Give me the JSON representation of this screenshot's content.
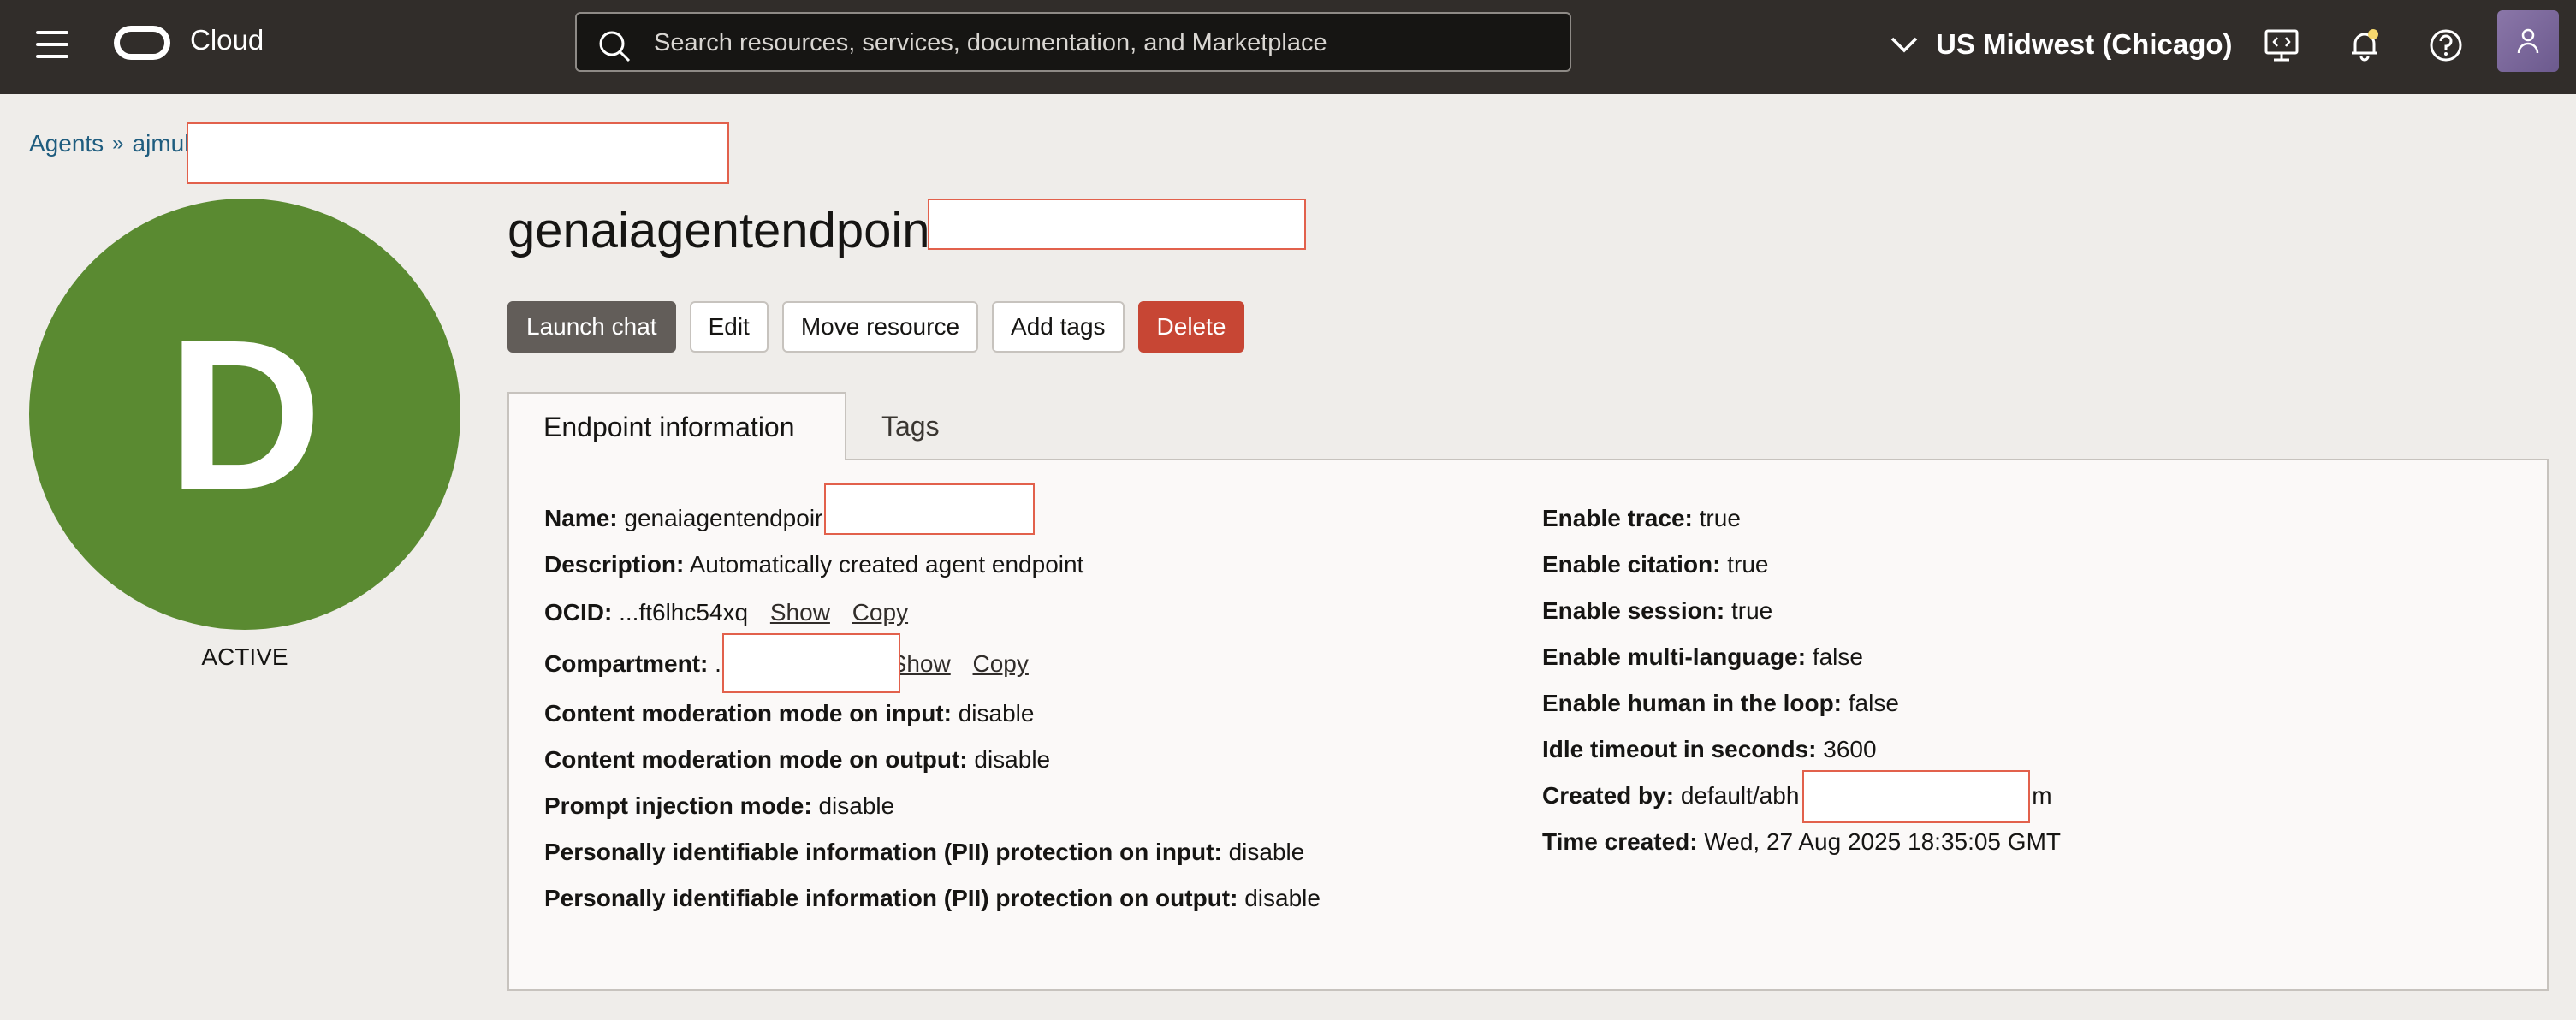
{
  "header": {
    "brand": "Cloud",
    "search_placeholder": "Search resources, services, documentation, and Marketplace",
    "region": "US Midwest (Chicago)"
  },
  "breadcrumb": {
    "root": "Agents",
    "current": "ajmul"
  },
  "resource": {
    "title": "genaiagentendpoint",
    "avatar_letter": "D",
    "avatar_color": "#5a8a31",
    "status": "ACTIVE"
  },
  "actions": {
    "launch_chat": "Launch chat",
    "edit": "Edit",
    "move_resource": "Move resource",
    "add_tags": "Add tags",
    "delete": "Delete"
  },
  "tabs": {
    "endpoint_info": "Endpoint information",
    "tags": "Tags"
  },
  "info_left": {
    "name_label": "Name:",
    "name_value": "genaiagentendpoir",
    "description_label": "Description:",
    "description_value": "Automatically created agent endpoint",
    "ocid_label": "OCID:",
    "ocid_value": "...ft6lhc54xq",
    "ocid_show": "Show",
    "ocid_copy": "Copy",
    "compartment_label": "Compartment:",
    "compartment_value": ".",
    "compartment_show": "Show",
    "compartment_copy": "Copy",
    "cm_input_label": "Content moderation mode on input:",
    "cm_input_value": "disable",
    "cm_output_label": "Content moderation mode on output:",
    "cm_output_value": "disable",
    "prompt_injection_label": "Prompt injection mode:",
    "prompt_injection_value": "disable",
    "pii_input_label": "Personally identifiable information (PII) protection on input:",
    "pii_input_value": "disable",
    "pii_output_label": "Personally identifiable information (PII) protection on output:",
    "pii_output_value": "disable"
  },
  "info_right": {
    "trace_label": "Enable trace:",
    "trace_value": "true",
    "citation_label": "Enable citation:",
    "citation_value": "true",
    "session_label": "Enable session:",
    "session_value": "true",
    "multilang_label": "Enable multi-language:",
    "multilang_value": "false",
    "hitl_label": "Enable human in the loop:",
    "hitl_value": "false",
    "idle_label": "Idle timeout in seconds:",
    "idle_value": "3600",
    "created_by_label": "Created by:",
    "created_by_value": "default/abh",
    "created_by_suffix": "m",
    "time_created_label": "Time created:",
    "time_created_value": "Wed, 27 Aug 2025 18:35:05 GMT"
  },
  "colors": {
    "topbar": "#312d2a",
    "primary_button": "#625d59",
    "danger_button": "#c74634",
    "link": "#1f5d7f",
    "redaction_border": "#e2614c"
  }
}
